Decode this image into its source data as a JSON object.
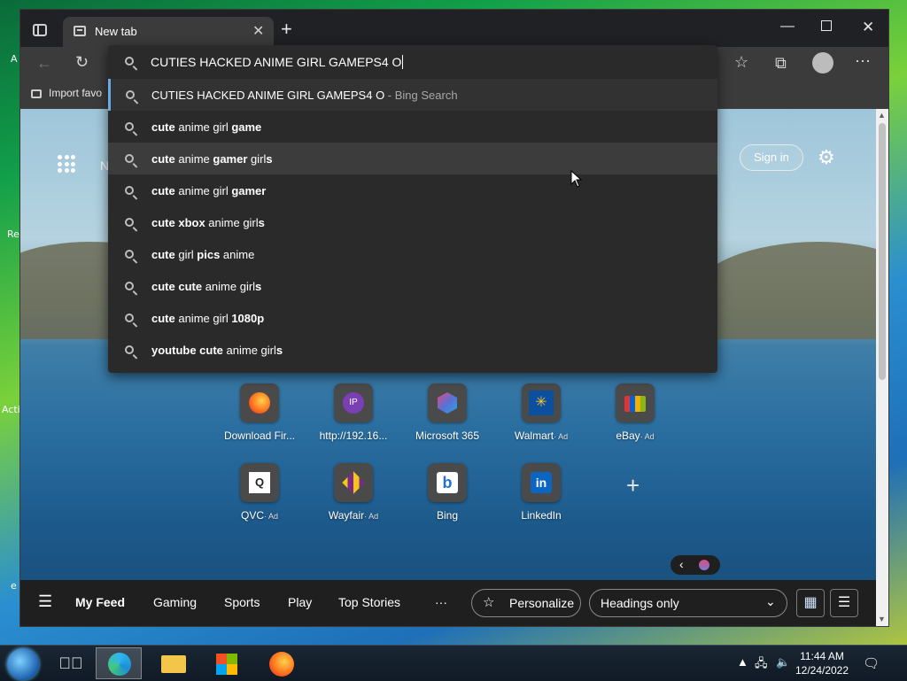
{
  "desktop": {
    "frags": [
      "A",
      "Re",
      "Acti",
      "e"
    ]
  },
  "browser": {
    "tab_title": "New tab",
    "favorites_import": "Import favo",
    "page_n": "N",
    "signin_label": "Sign in"
  },
  "omnibox": {
    "query": "CUTIES HACKED ANIME GIRL GAMEPS4 O",
    "first": {
      "text": "CUTIES HACKED ANIME GIRL GAMEPS4 O",
      "suffix": " - Bing Search"
    },
    "suggestions": [
      [
        [
          "cute",
          true
        ],
        [
          " anime girl ",
          false
        ],
        [
          "game",
          true
        ]
      ],
      [
        [
          "cute",
          true
        ],
        [
          " anime ",
          false
        ],
        [
          "gamer",
          true
        ],
        [
          " girl",
          false
        ],
        [
          "s",
          true
        ]
      ],
      [
        [
          "cute",
          true
        ],
        [
          " anime girl ",
          false
        ],
        [
          "gamer",
          true
        ]
      ],
      [
        [
          "cute xbox",
          true
        ],
        [
          " anime girl",
          false
        ],
        [
          "s",
          true
        ]
      ],
      [
        [
          "cute",
          true
        ],
        [
          " girl ",
          false
        ],
        [
          "pics",
          true
        ],
        [
          " anime",
          false
        ]
      ],
      [
        [
          "cute cute",
          true
        ],
        [
          " anime girl",
          false
        ],
        [
          "s",
          true
        ]
      ],
      [
        [
          "cute",
          true
        ],
        [
          " anime girl ",
          false
        ],
        [
          "1080p",
          true
        ]
      ],
      [
        [
          "youtube cute",
          true
        ],
        [
          " anime girl",
          false
        ],
        [
          "s",
          true
        ]
      ]
    ]
  },
  "tiles": [
    {
      "label": "Download Fir...",
      "ad": "",
      "icon": "firefox-icon",
      "color": "#ff6a1a",
      "glyph": ""
    },
    {
      "label": "http://192.16...",
      "ad": "",
      "icon": "ip-icon",
      "color": "#7a3fb5",
      "glyph": "IP"
    },
    {
      "label": "Microsoft 365",
      "ad": "",
      "icon": "microsoft365-icon",
      "color": "#5b6fd6",
      "glyph": ""
    },
    {
      "label": "Walmart",
      "ad": "· Ad",
      "icon": "walmart-icon",
      "color": "#0a4fa0",
      "glyph": "✳"
    },
    {
      "label": "eBay",
      "ad": "· Ad",
      "icon": "ebay-icon",
      "color": "#1a1a1a",
      "glyph": "🛍"
    },
    {
      "label": "QVC",
      "ad": "· Ad",
      "icon": "qvc-icon",
      "color": "#ffffff",
      "glyph": "Q"
    },
    {
      "label": "Wayfair",
      "ad": "· Ad",
      "icon": "wayfair-icon",
      "color": "#7b2a8a",
      "glyph": "◆"
    },
    {
      "label": "Bing",
      "ad": "",
      "icon": "bing-icon",
      "color": "#ffffff",
      "glyph": "b"
    },
    {
      "label": "LinkedIn",
      "ad": "",
      "icon": "linkedin-icon",
      "color": "#0a66c2",
      "glyph": "in"
    }
  ],
  "feed": {
    "nav": [
      "My Feed",
      "Gaming",
      "Sports",
      "Play",
      "Top Stories"
    ],
    "more": "···",
    "personalize": "Personalize",
    "layout_select": "Headings only"
  },
  "taskbar": {
    "time": "11:44 AM",
    "date": "12/24/2022"
  }
}
